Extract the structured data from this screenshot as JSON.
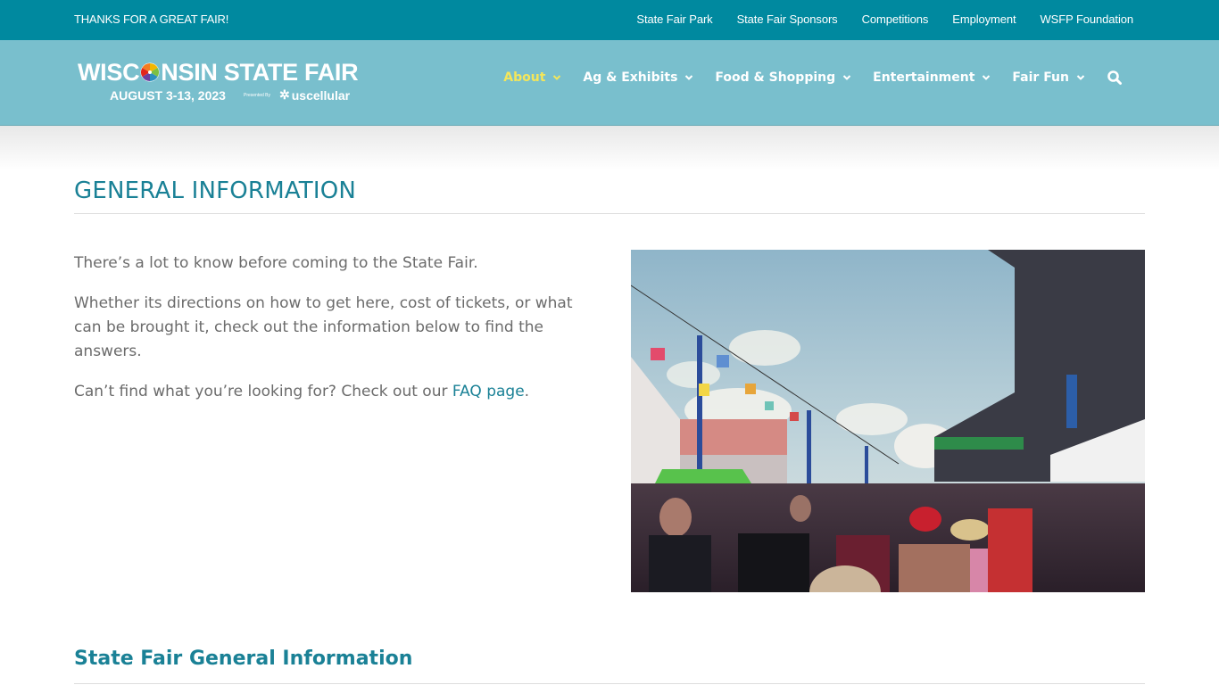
{
  "topbar": {
    "tagline": "THANKS FOR A GREAT FAIR!",
    "links": [
      "State Fair Park",
      "State Fair Sponsors",
      "Competitions",
      "Employment",
      "WSFP Foundation"
    ],
    "background": "#00899f"
  },
  "header": {
    "background": "#79bfcd",
    "logo": {
      "title_pre": "WISC",
      "title_post": "NSIN STATE FAIR",
      "dates": "AUGUST 3-13, 2023",
      "presented_by": "Presented By",
      "sponsor": "uscellular"
    },
    "nav": [
      {
        "label": "About",
        "active": true,
        "icon": "chevron-down-icon"
      },
      {
        "label": "Ag & Exhibits",
        "active": false,
        "icon": "chevron-down-icon"
      },
      {
        "label": "Food & Shopping",
        "active": false,
        "icon": "chevron-down-icon"
      },
      {
        "label": "Entertainment",
        "active": false,
        "icon": "chevron-down-icon"
      },
      {
        "label": "Fair Fun",
        "active": false,
        "icon": "chevron-down-icon"
      }
    ],
    "search_icon": "search-icon",
    "active_color": "#f4e65a"
  },
  "main": {
    "title": "GENERAL INFORMATION",
    "paragraphs": [
      "There’s a lot to know before coming to the State Fair.",
      "Whether its directions on how to get here, cost of tickets, or what can be brought it, check out the information below to find the answers."
    ],
    "faq_prefix": "Can’t find what you’re looking for? Check out our ",
    "faq_link": "FAQ page",
    "faq_suffix": ".",
    "image_alt": "Crowd at the Wisconsin State Fair with sky glider chairs overhead",
    "section_title": "State Fair General Information",
    "accent_color": "#1a8196"
  }
}
